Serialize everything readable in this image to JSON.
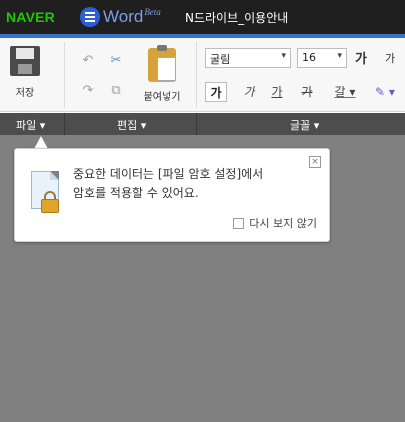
{
  "titlebar": {
    "brand": "NAVER",
    "app_name": "Word",
    "app_badge": "Beta",
    "document_title": "N드라이브_이용안내"
  },
  "ribbon": {
    "save_label": "저장",
    "paste_label": "붙여넣기",
    "font_name": "굴림",
    "font_size": "16",
    "dropdown_glyph": "▾",
    "grow_glyph": "가",
    "shrink_glyph": "가",
    "bold_glyph": "가",
    "italic_glyph": "가",
    "underline_glyph": "가",
    "strike_glyph": "가",
    "color_glyph": "갈 ▾",
    "highlight_glyph": "✎ ▾",
    "undo_glyph": "↶",
    "redo_glyph": "↷",
    "copy_glyph": "⧉",
    "cut_glyph": "✂"
  },
  "groups": {
    "file": "파일 ▾",
    "edit": "편집 ▾",
    "font": "글꼴 ▾"
  },
  "popup": {
    "message_line1": "중요한 데이터는 [파일 암호 설정]에서",
    "message_line2": "암호를 적용할 수 있어요.",
    "dismiss_label": "다시 보지 않기",
    "close_glyph": "×"
  }
}
